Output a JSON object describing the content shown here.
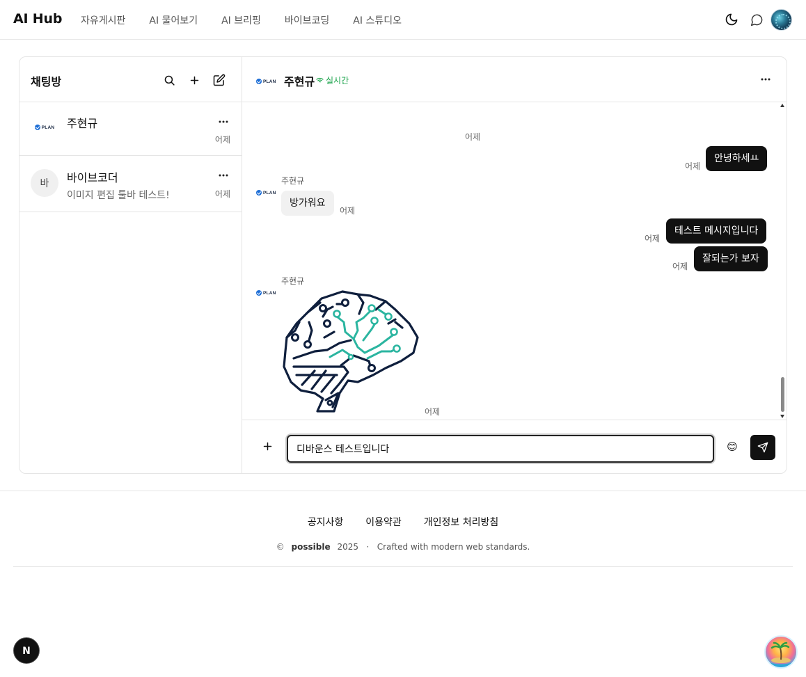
{
  "nav": {
    "brand": "AI Hub",
    "links": [
      "자유게시판",
      "AI 물어보기",
      "AI 브리핑",
      "바이브코딩",
      "AI 스튜디오"
    ]
  },
  "sidebar": {
    "title": "채팅방",
    "rooms": [
      {
        "name": "주현규",
        "preview": "",
        "time": "어제",
        "avatar_logo": "PLAN"
      },
      {
        "name": "바이브코더",
        "preview": "이미지 편집 툴바 테스트!",
        "time": "어제",
        "avatar_initial": "바"
      }
    ]
  },
  "chat": {
    "partner_name": "주현규",
    "partner_logo": "PLAN",
    "live_label": "실시간",
    "day_label": "어제",
    "messages": [
      {
        "direction": "out",
        "text": "안녕하세ㅛ",
        "time": "어제"
      },
      {
        "direction": "in",
        "sender": "주현규",
        "text": "방가워요",
        "time": "어제"
      },
      {
        "direction": "out",
        "text": "테스트 메시지입니다",
        "time": "어제"
      },
      {
        "direction": "out",
        "text": "잘되는가 보자",
        "time": "어제"
      },
      {
        "direction": "in",
        "sender": "주현규",
        "image": "brain-circuit-image",
        "time": "어제"
      }
    ],
    "input_value": "디바운스 테스트입니다",
    "emoji": "😊"
  },
  "footer": {
    "links": [
      "공지사항",
      "이용약관",
      "개인정보 처리방침"
    ],
    "copyright_symbol": "©",
    "company": "possible",
    "year": "2025",
    "separator": "·",
    "tagline": "Crafted with modern web standards."
  },
  "badges": {
    "next_letter": "N"
  },
  "colors": {
    "accent": "#111111",
    "live": "#1aa34a",
    "brain_dark": "#0f1f3d",
    "brain_teal": "#2bb5a0"
  }
}
